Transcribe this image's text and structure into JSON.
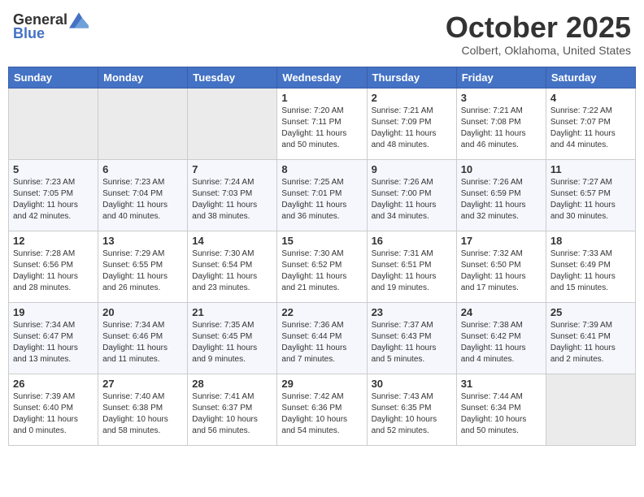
{
  "header": {
    "logo_general": "General",
    "logo_blue": "Blue",
    "month_title": "October 2025",
    "location": "Colbert, Oklahoma, United States"
  },
  "weekdays": [
    "Sunday",
    "Monday",
    "Tuesday",
    "Wednesday",
    "Thursday",
    "Friday",
    "Saturday"
  ],
  "weeks": [
    [
      {
        "day": "",
        "sunrise": "",
        "sunset": "",
        "daylight": ""
      },
      {
        "day": "",
        "sunrise": "",
        "sunset": "",
        "daylight": ""
      },
      {
        "day": "",
        "sunrise": "",
        "sunset": "",
        "daylight": ""
      },
      {
        "day": "1",
        "sunrise": "Sunrise: 7:20 AM",
        "sunset": "Sunset: 7:11 PM",
        "daylight": "Daylight: 11 hours and 50 minutes."
      },
      {
        "day": "2",
        "sunrise": "Sunrise: 7:21 AM",
        "sunset": "Sunset: 7:09 PM",
        "daylight": "Daylight: 11 hours and 48 minutes."
      },
      {
        "day": "3",
        "sunrise": "Sunrise: 7:21 AM",
        "sunset": "Sunset: 7:08 PM",
        "daylight": "Daylight: 11 hours and 46 minutes."
      },
      {
        "day": "4",
        "sunrise": "Sunrise: 7:22 AM",
        "sunset": "Sunset: 7:07 PM",
        "daylight": "Daylight: 11 hours and 44 minutes."
      }
    ],
    [
      {
        "day": "5",
        "sunrise": "Sunrise: 7:23 AM",
        "sunset": "Sunset: 7:05 PM",
        "daylight": "Daylight: 11 hours and 42 minutes."
      },
      {
        "day": "6",
        "sunrise": "Sunrise: 7:23 AM",
        "sunset": "Sunset: 7:04 PM",
        "daylight": "Daylight: 11 hours and 40 minutes."
      },
      {
        "day": "7",
        "sunrise": "Sunrise: 7:24 AM",
        "sunset": "Sunset: 7:03 PM",
        "daylight": "Daylight: 11 hours and 38 minutes."
      },
      {
        "day": "8",
        "sunrise": "Sunrise: 7:25 AM",
        "sunset": "Sunset: 7:01 PM",
        "daylight": "Daylight: 11 hours and 36 minutes."
      },
      {
        "day": "9",
        "sunrise": "Sunrise: 7:26 AM",
        "sunset": "Sunset: 7:00 PM",
        "daylight": "Daylight: 11 hours and 34 minutes."
      },
      {
        "day": "10",
        "sunrise": "Sunrise: 7:26 AM",
        "sunset": "Sunset: 6:59 PM",
        "daylight": "Daylight: 11 hours and 32 minutes."
      },
      {
        "day": "11",
        "sunrise": "Sunrise: 7:27 AM",
        "sunset": "Sunset: 6:57 PM",
        "daylight": "Daylight: 11 hours and 30 minutes."
      }
    ],
    [
      {
        "day": "12",
        "sunrise": "Sunrise: 7:28 AM",
        "sunset": "Sunset: 6:56 PM",
        "daylight": "Daylight: 11 hours and 28 minutes."
      },
      {
        "day": "13",
        "sunrise": "Sunrise: 7:29 AM",
        "sunset": "Sunset: 6:55 PM",
        "daylight": "Daylight: 11 hours and 26 minutes."
      },
      {
        "day": "14",
        "sunrise": "Sunrise: 7:30 AM",
        "sunset": "Sunset: 6:54 PM",
        "daylight": "Daylight: 11 hours and 23 minutes."
      },
      {
        "day": "15",
        "sunrise": "Sunrise: 7:30 AM",
        "sunset": "Sunset: 6:52 PM",
        "daylight": "Daylight: 11 hours and 21 minutes."
      },
      {
        "day": "16",
        "sunrise": "Sunrise: 7:31 AM",
        "sunset": "Sunset: 6:51 PM",
        "daylight": "Daylight: 11 hours and 19 minutes."
      },
      {
        "day": "17",
        "sunrise": "Sunrise: 7:32 AM",
        "sunset": "Sunset: 6:50 PM",
        "daylight": "Daylight: 11 hours and 17 minutes."
      },
      {
        "day": "18",
        "sunrise": "Sunrise: 7:33 AM",
        "sunset": "Sunset: 6:49 PM",
        "daylight": "Daylight: 11 hours and 15 minutes."
      }
    ],
    [
      {
        "day": "19",
        "sunrise": "Sunrise: 7:34 AM",
        "sunset": "Sunset: 6:47 PM",
        "daylight": "Daylight: 11 hours and 13 minutes."
      },
      {
        "day": "20",
        "sunrise": "Sunrise: 7:34 AM",
        "sunset": "Sunset: 6:46 PM",
        "daylight": "Daylight: 11 hours and 11 minutes."
      },
      {
        "day": "21",
        "sunrise": "Sunrise: 7:35 AM",
        "sunset": "Sunset: 6:45 PM",
        "daylight": "Daylight: 11 hours and 9 minutes."
      },
      {
        "day": "22",
        "sunrise": "Sunrise: 7:36 AM",
        "sunset": "Sunset: 6:44 PM",
        "daylight": "Daylight: 11 hours and 7 minutes."
      },
      {
        "day": "23",
        "sunrise": "Sunrise: 7:37 AM",
        "sunset": "Sunset: 6:43 PM",
        "daylight": "Daylight: 11 hours and 5 minutes."
      },
      {
        "day": "24",
        "sunrise": "Sunrise: 7:38 AM",
        "sunset": "Sunset: 6:42 PM",
        "daylight": "Daylight: 11 hours and 4 minutes."
      },
      {
        "day": "25",
        "sunrise": "Sunrise: 7:39 AM",
        "sunset": "Sunset: 6:41 PM",
        "daylight": "Daylight: 11 hours and 2 minutes."
      }
    ],
    [
      {
        "day": "26",
        "sunrise": "Sunrise: 7:39 AM",
        "sunset": "Sunset: 6:40 PM",
        "daylight": "Daylight: 11 hours and 0 minutes."
      },
      {
        "day": "27",
        "sunrise": "Sunrise: 7:40 AM",
        "sunset": "Sunset: 6:38 PM",
        "daylight": "Daylight: 10 hours and 58 minutes."
      },
      {
        "day": "28",
        "sunrise": "Sunrise: 7:41 AM",
        "sunset": "Sunset: 6:37 PM",
        "daylight": "Daylight: 10 hours and 56 minutes."
      },
      {
        "day": "29",
        "sunrise": "Sunrise: 7:42 AM",
        "sunset": "Sunset: 6:36 PM",
        "daylight": "Daylight: 10 hours and 54 minutes."
      },
      {
        "day": "30",
        "sunrise": "Sunrise: 7:43 AM",
        "sunset": "Sunset: 6:35 PM",
        "daylight": "Daylight: 10 hours and 52 minutes."
      },
      {
        "day": "31",
        "sunrise": "Sunrise: 7:44 AM",
        "sunset": "Sunset: 6:34 PM",
        "daylight": "Daylight: 10 hours and 50 minutes."
      },
      {
        "day": "",
        "sunrise": "",
        "sunset": "",
        "daylight": ""
      }
    ]
  ]
}
